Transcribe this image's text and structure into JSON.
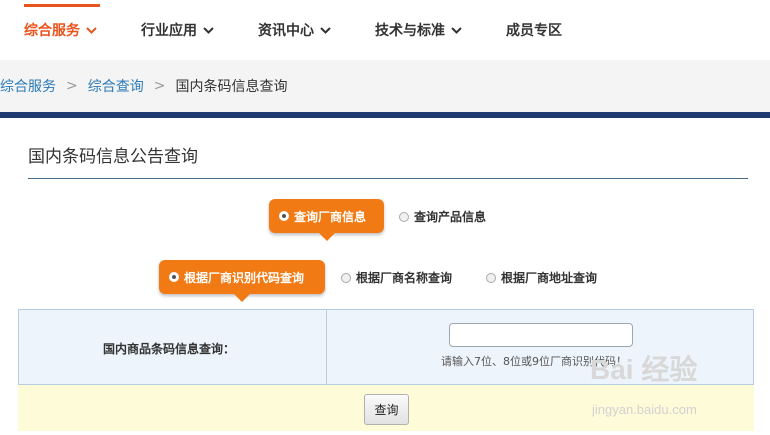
{
  "nav": {
    "items": [
      {
        "label": "综合服务",
        "has_dropdown": true,
        "active": true
      },
      {
        "label": "行业应用",
        "has_dropdown": true,
        "active": false
      },
      {
        "label": "资讯中心",
        "has_dropdown": true,
        "active": false
      },
      {
        "label": "技术与标准",
        "has_dropdown": true,
        "active": false
      },
      {
        "label": "成员专区",
        "has_dropdown": false,
        "active": false
      }
    ],
    "chevron_icon": "chevron-down-icon"
  },
  "breadcrumb": {
    "items": [
      "综合服务",
      "综合查询",
      "国内条码信息查询"
    ],
    "separator": ">"
  },
  "page": {
    "title": "国内条码信息公告查询"
  },
  "query_type": {
    "options": [
      {
        "label": "查询厂商信息",
        "selected": true
      },
      {
        "label": "查询产品信息",
        "selected": false
      }
    ]
  },
  "query_method": {
    "options": [
      {
        "label": "根据厂商识别代码查询",
        "selected": true
      },
      {
        "label": "根据厂商名称查询",
        "selected": false
      },
      {
        "label": "根据厂商地址查询",
        "selected": false
      }
    ]
  },
  "form": {
    "label": "国内商品条码信息查询：",
    "input_value": "",
    "hint": "请输入7位、8位或9位厂商识别代码！",
    "submit_label": "查询"
  },
  "watermark": {
    "text": "Bai 经验",
    "sub": "jingyan.baidu.com"
  },
  "colors": {
    "accent": "#e8541e",
    "pill": "#f27a14",
    "link": "#2a7ab8",
    "dark_bar": "#1e3c72",
    "form_bg": "#eef4fb",
    "submit_bg": "#fdfbd8"
  }
}
